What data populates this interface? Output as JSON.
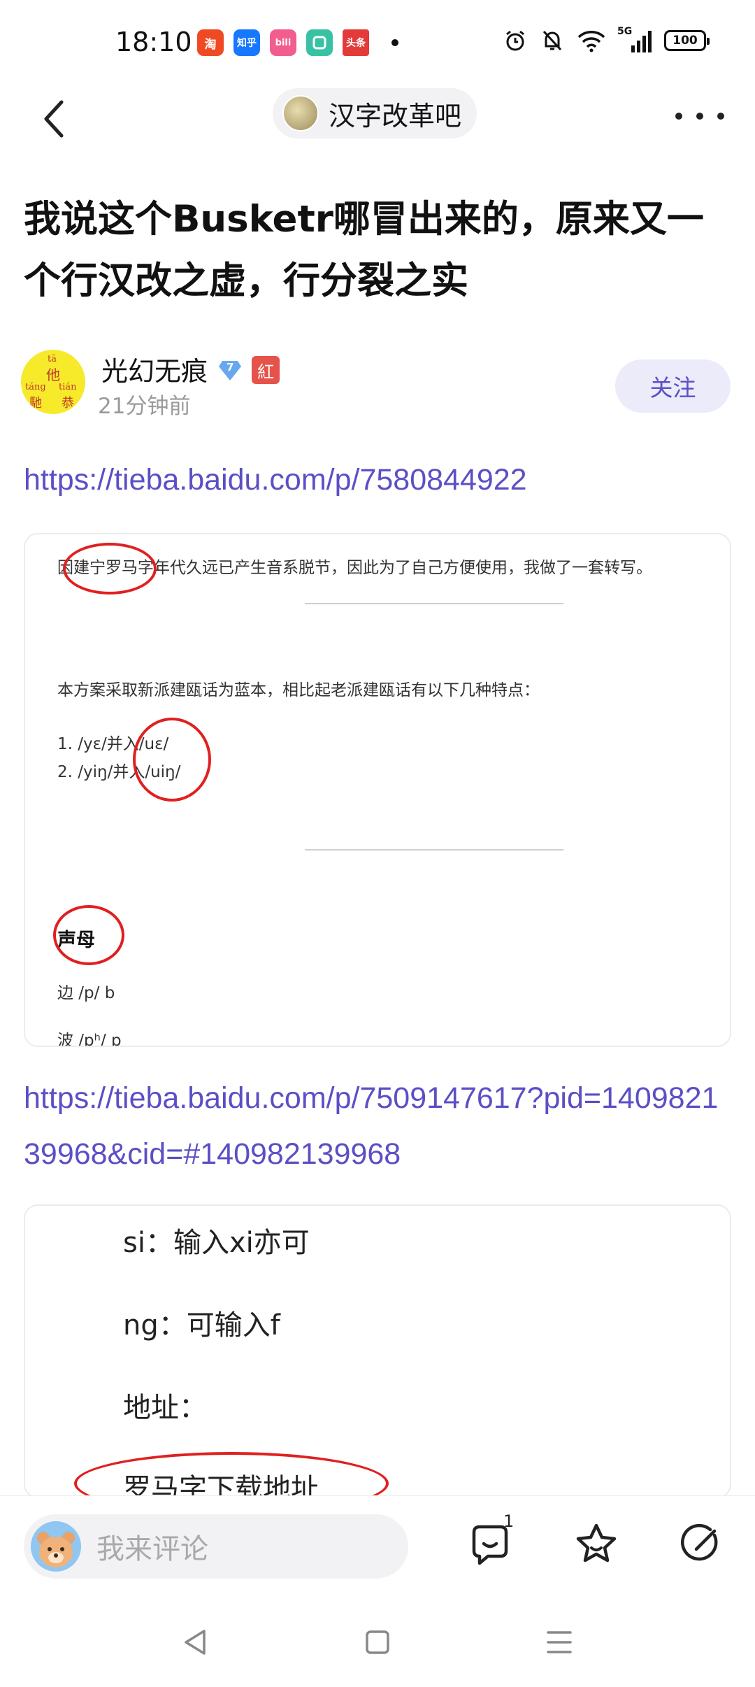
{
  "status_bar": {
    "time": "18:10",
    "apps": [
      {
        "name": "taobao-app-icon",
        "label": "淘",
        "color": "#f04a25"
      },
      {
        "name": "zhihu-app-icon",
        "label": "知乎",
        "color": "#1677ff"
      },
      {
        "name": "bilibili-app-icon",
        "label": "bili",
        "color": "#f25d8e"
      },
      {
        "name": "window-app-icon",
        "label": "",
        "color": "#38c2a3"
      },
      {
        "name": "toutiao-app-icon",
        "label": "头条",
        "color": "#e33a3a"
      }
    ],
    "network": "5G",
    "battery": "100"
  },
  "nav": {
    "forum_name": "汉字改革吧"
  },
  "post": {
    "title": "我说这个Busketr哪冒出来的，原来又一个行汉改之虚，行分裂之实",
    "author_name": "光幻无痕",
    "level": "7",
    "badge": "紅",
    "time": "21分钟前",
    "follow_label": "关注",
    "avatar_chars": [
      "tā",
      "他",
      "táng",
      "tián",
      "馳",
      "恭"
    ],
    "link1": "https://tieba.baidu.com/p/7580844922",
    "link2": "https://tieba.baidu.com/p/7509147617?pid=140982139968&cid=#140982139968"
  },
  "image1": {
    "line1": "因建宁罗马字年代久远已产生音系脱节，因此为了自己方便使用，我做了一套转写。",
    "line2": "本方案采取新派建瓯话为蓝本，相比起老派建瓯话有以下几种特点：",
    "item1": "1. /yɛ/并入/uɛ/",
    "item2": "2. /yiŋ/并入/uiŋ/",
    "heading": "声母",
    "row1": "边 /p/ b",
    "row2": "波 /pʰ/ p"
  },
  "image2": {
    "line1": "si：输入xi亦可",
    "line2": "ng：可输入f",
    "line3": "地址：",
    "line4": "罗马字下载地址"
  },
  "bottom_bar": {
    "comment_placeholder": "我来评论",
    "comment_count": "1"
  },
  "colors": {
    "accent": "#5b4fc6",
    "annotation_red": "#e02020"
  }
}
